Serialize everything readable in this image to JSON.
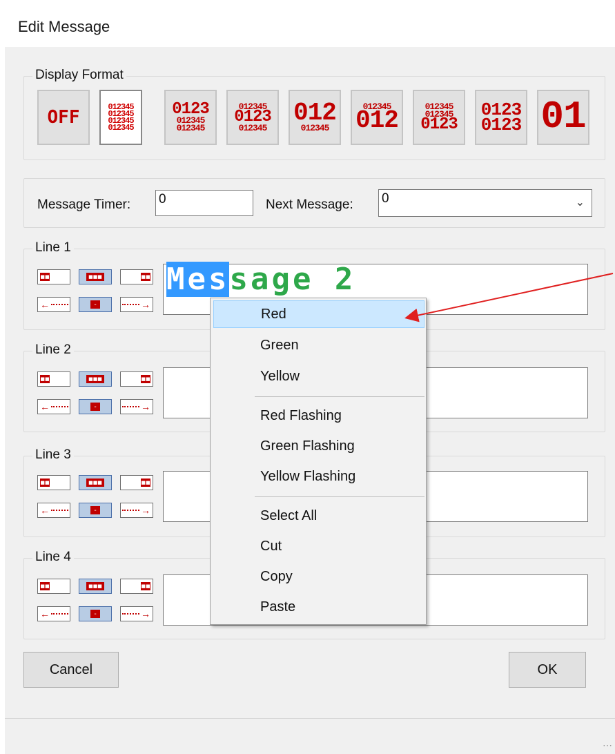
{
  "window": {
    "title": "Edit Message"
  },
  "display_format": {
    "legend": "Display Format",
    "buttons": [
      {
        "id": "off",
        "lines": [
          "OFF"
        ]
      },
      {
        "id": "black-4",
        "lines": [
          "012345",
          "012345",
          "012345",
          "012345"
        ]
      },
      {
        "id": "big-small",
        "lines": [
          "0123",
          "012345",
          "012345"
        ]
      },
      {
        "id": "small-big-small",
        "lines": [
          "012345",
          "0123",
          "012345"
        ]
      },
      {
        "id": "large-small",
        "lines": [
          "012",
          "012345"
        ]
      },
      {
        "id": "small-large",
        "lines": [
          "012345",
          "012"
        ]
      },
      {
        "id": "small-small-big",
        "lines": [
          "012345",
          "012345",
          "0123"
        ]
      },
      {
        "id": "two-medium",
        "lines": [
          "0123",
          "0123"
        ]
      },
      {
        "id": "one-large",
        "lines": [
          "01"
        ]
      }
    ]
  },
  "timer": {
    "message_timer_label": "Message Timer:",
    "message_timer_value": "0",
    "next_message_label": "Next Message:",
    "next_message_value": "0"
  },
  "lines": [
    {
      "legend": "Line 1",
      "text_plain": "sage 2",
      "text_selected": "Mes"
    },
    {
      "legend": "Line 2"
    },
    {
      "legend": "Line 3"
    },
    {
      "legend": "Line 4"
    }
  ],
  "mini_buttons": {
    "center_dash": "-"
  },
  "buttons": {
    "cancel": "Cancel",
    "ok": "OK"
  },
  "context_menu": {
    "items": [
      "Red",
      "Green",
      "Yellow",
      "Red Flashing",
      "Green Flashing",
      "Yellow Flashing",
      "Select All",
      "Cut",
      "Copy",
      "Paste"
    ],
    "highlighted": "Red"
  },
  "colors": {
    "led_red": "#c00000",
    "led_green": "#2ea84a",
    "selection_blue": "#3399ff",
    "menu_hover": "#cce8ff",
    "annotation_arrow": "#e02020"
  }
}
